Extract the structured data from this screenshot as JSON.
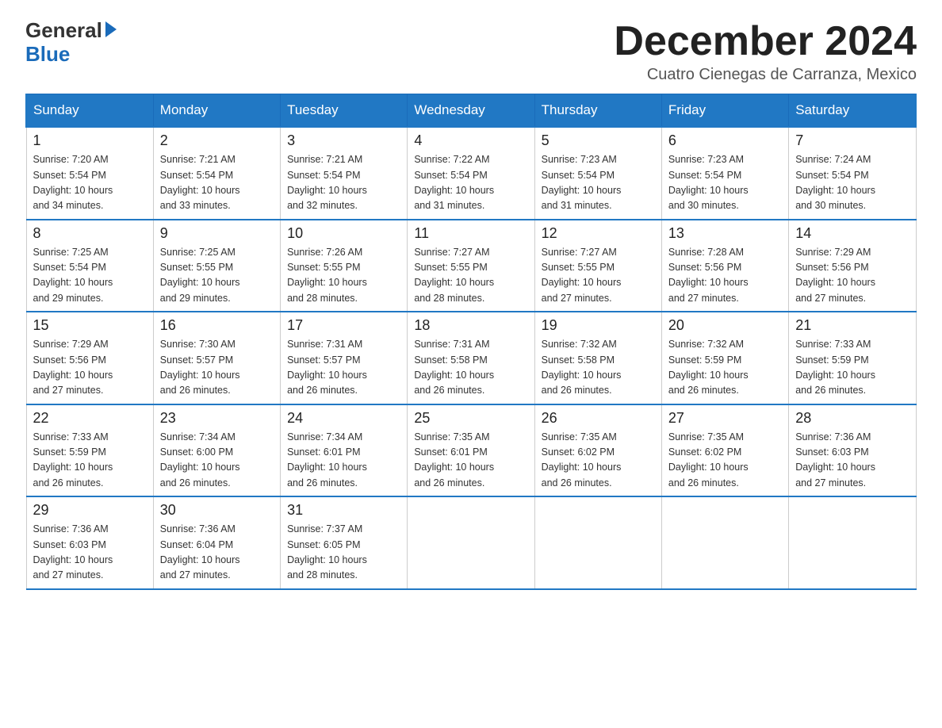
{
  "header": {
    "month_title": "December 2024",
    "location": "Cuatro Cienegas de Carranza, Mexico",
    "logo_general": "General",
    "logo_blue": "Blue"
  },
  "days_of_week": [
    "Sunday",
    "Monday",
    "Tuesday",
    "Wednesday",
    "Thursday",
    "Friday",
    "Saturday"
  ],
  "weeks": [
    [
      {
        "day": "1",
        "sunrise": "7:20 AM",
        "sunset": "5:54 PM",
        "daylight": "10 hours and 34 minutes."
      },
      {
        "day": "2",
        "sunrise": "7:21 AM",
        "sunset": "5:54 PM",
        "daylight": "10 hours and 33 minutes."
      },
      {
        "day": "3",
        "sunrise": "7:21 AM",
        "sunset": "5:54 PM",
        "daylight": "10 hours and 32 minutes."
      },
      {
        "day": "4",
        "sunrise": "7:22 AM",
        "sunset": "5:54 PM",
        "daylight": "10 hours and 31 minutes."
      },
      {
        "day": "5",
        "sunrise": "7:23 AM",
        "sunset": "5:54 PM",
        "daylight": "10 hours and 31 minutes."
      },
      {
        "day": "6",
        "sunrise": "7:23 AM",
        "sunset": "5:54 PM",
        "daylight": "10 hours and 30 minutes."
      },
      {
        "day": "7",
        "sunrise": "7:24 AM",
        "sunset": "5:54 PM",
        "daylight": "10 hours and 30 minutes."
      }
    ],
    [
      {
        "day": "8",
        "sunrise": "7:25 AM",
        "sunset": "5:54 PM",
        "daylight": "10 hours and 29 minutes."
      },
      {
        "day": "9",
        "sunrise": "7:25 AM",
        "sunset": "5:55 PM",
        "daylight": "10 hours and 29 minutes."
      },
      {
        "day": "10",
        "sunrise": "7:26 AM",
        "sunset": "5:55 PM",
        "daylight": "10 hours and 28 minutes."
      },
      {
        "day": "11",
        "sunrise": "7:27 AM",
        "sunset": "5:55 PM",
        "daylight": "10 hours and 28 minutes."
      },
      {
        "day": "12",
        "sunrise": "7:27 AM",
        "sunset": "5:55 PM",
        "daylight": "10 hours and 27 minutes."
      },
      {
        "day": "13",
        "sunrise": "7:28 AM",
        "sunset": "5:56 PM",
        "daylight": "10 hours and 27 minutes."
      },
      {
        "day": "14",
        "sunrise": "7:29 AM",
        "sunset": "5:56 PM",
        "daylight": "10 hours and 27 minutes."
      }
    ],
    [
      {
        "day": "15",
        "sunrise": "7:29 AM",
        "sunset": "5:56 PM",
        "daylight": "10 hours and 27 minutes."
      },
      {
        "day": "16",
        "sunrise": "7:30 AM",
        "sunset": "5:57 PM",
        "daylight": "10 hours and 26 minutes."
      },
      {
        "day": "17",
        "sunrise": "7:31 AM",
        "sunset": "5:57 PM",
        "daylight": "10 hours and 26 minutes."
      },
      {
        "day": "18",
        "sunrise": "7:31 AM",
        "sunset": "5:58 PM",
        "daylight": "10 hours and 26 minutes."
      },
      {
        "day": "19",
        "sunrise": "7:32 AM",
        "sunset": "5:58 PM",
        "daylight": "10 hours and 26 minutes."
      },
      {
        "day": "20",
        "sunrise": "7:32 AM",
        "sunset": "5:59 PM",
        "daylight": "10 hours and 26 minutes."
      },
      {
        "day": "21",
        "sunrise": "7:33 AM",
        "sunset": "5:59 PM",
        "daylight": "10 hours and 26 minutes."
      }
    ],
    [
      {
        "day": "22",
        "sunrise": "7:33 AM",
        "sunset": "5:59 PM",
        "daylight": "10 hours and 26 minutes."
      },
      {
        "day": "23",
        "sunrise": "7:34 AM",
        "sunset": "6:00 PM",
        "daylight": "10 hours and 26 minutes."
      },
      {
        "day": "24",
        "sunrise": "7:34 AM",
        "sunset": "6:01 PM",
        "daylight": "10 hours and 26 minutes."
      },
      {
        "day": "25",
        "sunrise": "7:35 AM",
        "sunset": "6:01 PM",
        "daylight": "10 hours and 26 minutes."
      },
      {
        "day": "26",
        "sunrise": "7:35 AM",
        "sunset": "6:02 PM",
        "daylight": "10 hours and 26 minutes."
      },
      {
        "day": "27",
        "sunrise": "7:35 AM",
        "sunset": "6:02 PM",
        "daylight": "10 hours and 26 minutes."
      },
      {
        "day": "28",
        "sunrise": "7:36 AM",
        "sunset": "6:03 PM",
        "daylight": "10 hours and 27 minutes."
      }
    ],
    [
      {
        "day": "29",
        "sunrise": "7:36 AM",
        "sunset": "6:03 PM",
        "daylight": "10 hours and 27 minutes."
      },
      {
        "day": "30",
        "sunrise": "7:36 AM",
        "sunset": "6:04 PM",
        "daylight": "10 hours and 27 minutes."
      },
      {
        "day": "31",
        "sunrise": "7:37 AM",
        "sunset": "6:05 PM",
        "daylight": "10 hours and 28 minutes."
      },
      null,
      null,
      null,
      null
    ]
  ]
}
